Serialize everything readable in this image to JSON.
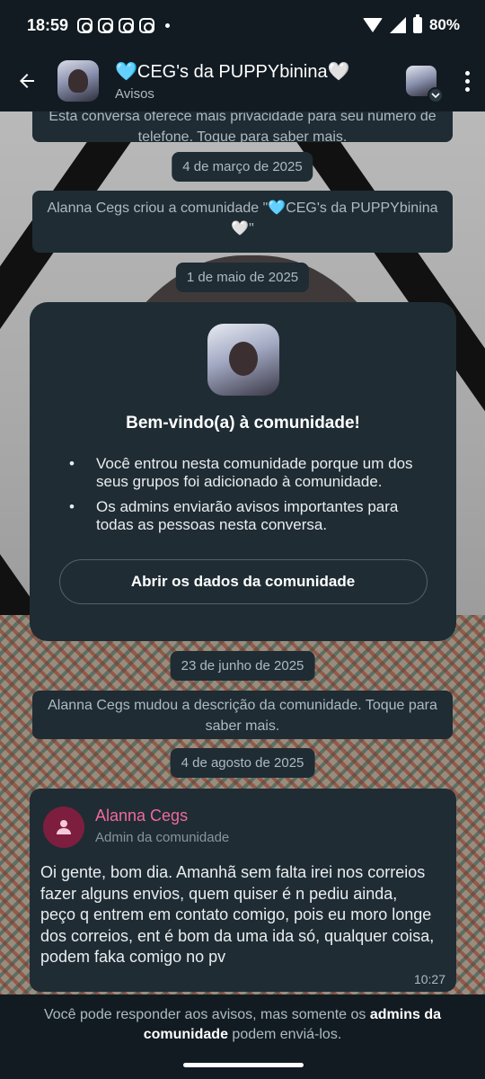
{
  "status_bar": {
    "time": "18:59",
    "battery": "80%"
  },
  "header": {
    "title": "🩵CEG's da PUPPYbinina🤍",
    "subtitle": "Avisos"
  },
  "chat": {
    "top_notice": "Esta conversa oferece mais privacidade para seu número de telefone. Toque para saber mais.",
    "date_1": "4 de março de 2025",
    "system_1": "Alanna Cegs criou a comunidade \"🩵CEG's da PUPPYbinina🤍\"",
    "date_2": "1 de maio de 2025",
    "welcome": {
      "title": "Bem-vindo(a) à comunidade!",
      "items": [
        "Você entrou nesta comunidade porque um dos seus grupos foi adicionado à comunidade.",
        "Os admins enviarão avisos importantes para todas as pessoas nesta conversa."
      ],
      "button_label": "Abrir os dados da comunidade"
    },
    "date_3": "23 de junho de 2025",
    "system_2": "Alanna Cegs mudou a descrição da comunidade. Toque para saber mais.",
    "date_4": "4 de agosto de 2025",
    "message": {
      "sender": "Alanna Cegs",
      "role": "Admin da comunidade",
      "text": "Oi gente, bom dia. Amanhã sem falta irei nos correios fazer alguns envios, quem quiser é n pediu ainda, peço q entrem em contato comigo, pois eu moro longe dos correios, ent é bom da uma ida só, qualquer coisa, podem faka comigo no pv",
      "time": "10:27"
    }
  },
  "footer": {
    "text_before": "Você pode responder aos avisos, mas somente os ",
    "text_bold": "admins da comunidade",
    "text_after": " podem enviá-los."
  },
  "colors": {
    "accent_pink": "#f06a9a",
    "avatar_maroon": "#7d1e3f",
    "bubble": "#1f2c34"
  }
}
